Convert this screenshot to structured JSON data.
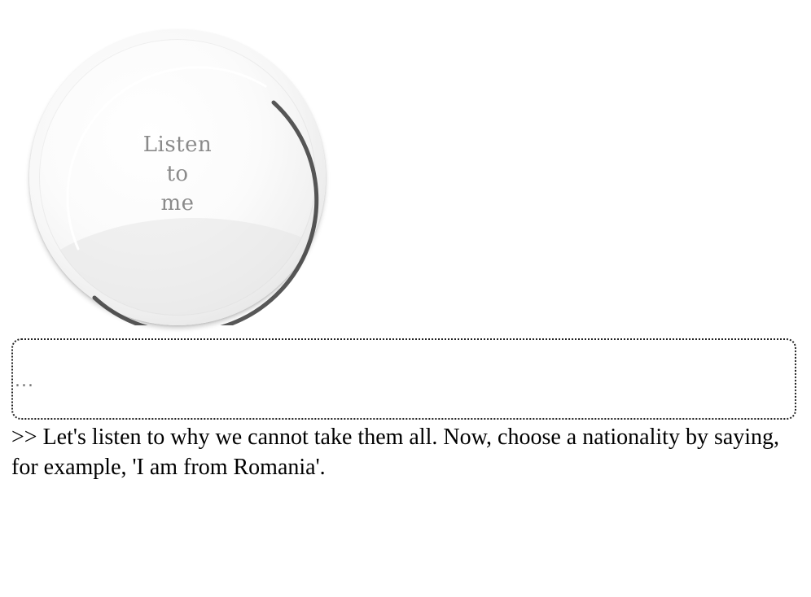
{
  "listen_button": {
    "line1": "Listen",
    "line2": "to",
    "line3": "me"
  },
  "transcript": {
    "text": "..."
  },
  "prompt": {
    "text": ">> Let's listen to why we cannot take them all. Now, choose a nationality by saying, for example, 'I am from Romania'."
  },
  "colors": {
    "border": "#222222",
    "label": "#8a8a8a",
    "text": "#000000"
  }
}
